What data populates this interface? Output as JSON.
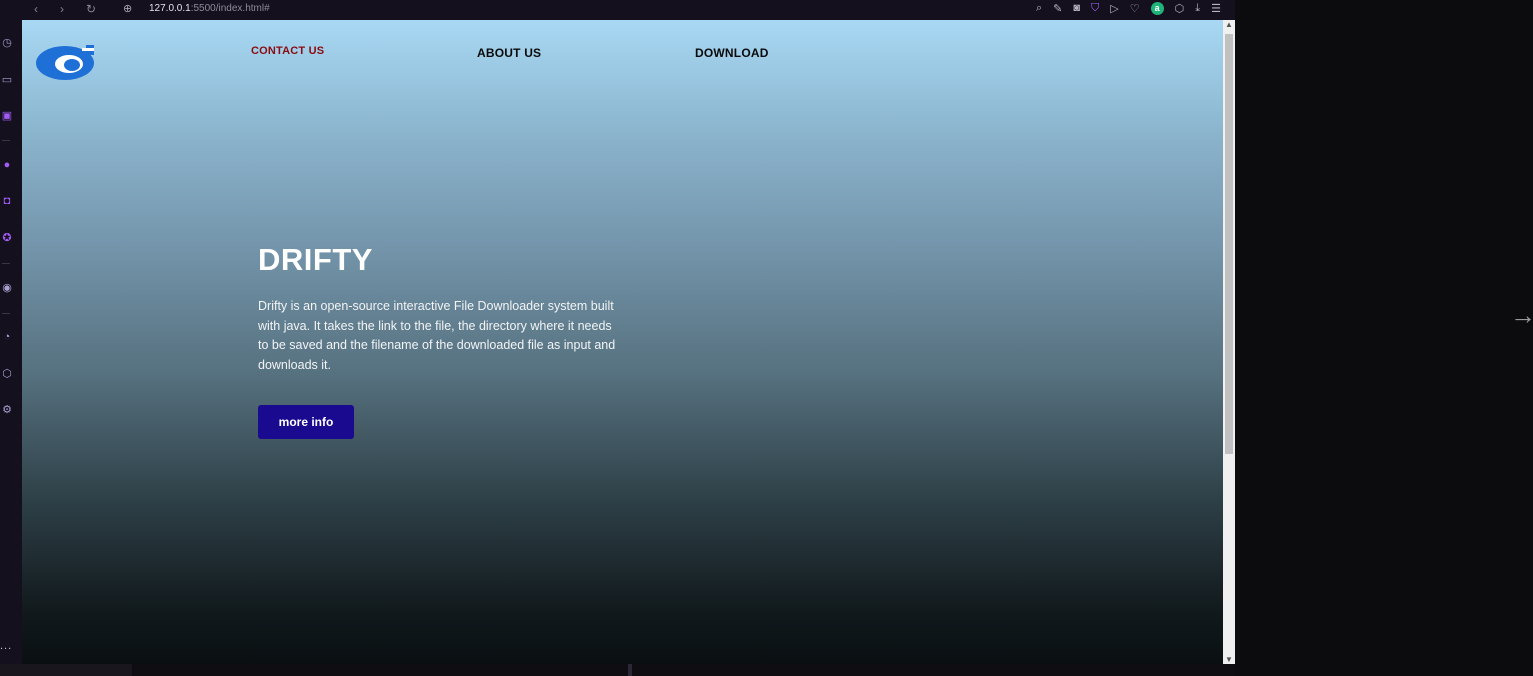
{
  "browser": {
    "back_icon": "‹",
    "forward_icon": "›",
    "reload_icon": "↻",
    "globe_icon": "⊕",
    "url_host": "127.0.0.1",
    "url_path": ":5500/index.html#",
    "toolbar_icons": [
      "search-icon",
      "edit-icon",
      "camera-icon",
      "shield-icon",
      "send-icon",
      "heart-icon",
      "account-a-icon",
      "cube-icon",
      "download-icon",
      "menu-icon"
    ],
    "account_letter": "a"
  },
  "sidebar": {
    "icons": [
      "speed-dial-icon",
      "wallet-icon",
      "twitch-icon",
      "whatsapp-icon",
      "instagram-icon",
      "messenger-icon",
      "player-icon",
      "history-icon",
      "cube-icon",
      "settings-icon"
    ],
    "more_label": "..."
  },
  "page": {
    "nav": {
      "contact": "CONTACT US",
      "about": "ABOUT US",
      "download": "DOWNLOAD"
    },
    "hero": {
      "title": "DRIFTY",
      "description": "Drifty is an open-source interactive File Downloader system built with java. It takes the link to the file, the directory where it needs to be saved and the filename of the downloaded file as input and downloads it.",
      "button": "more info"
    },
    "colors": {
      "contact_link": "#8b0b10",
      "button_bg": "#1a0a8f",
      "logo_blue": "#1e6fd6"
    }
  },
  "overlay": {
    "next_arrow": "→"
  }
}
